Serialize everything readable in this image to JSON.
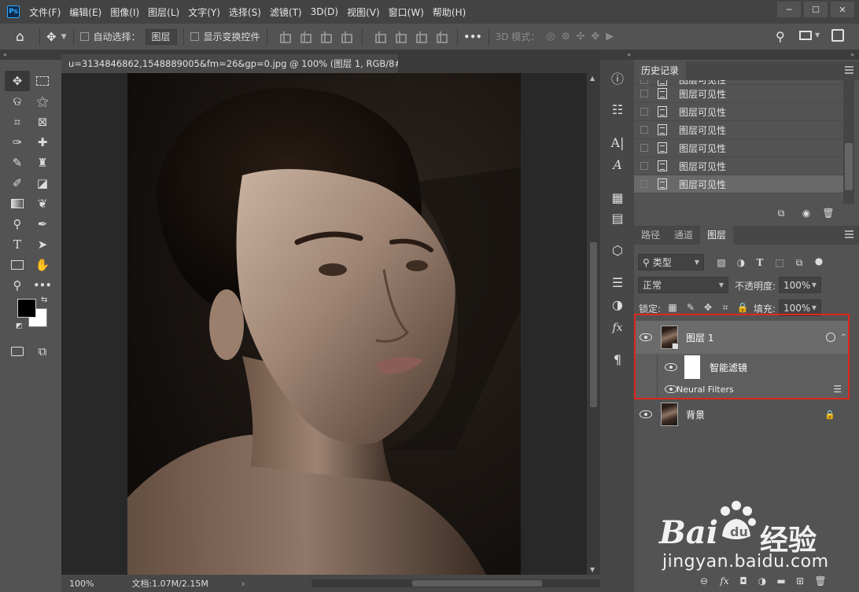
{
  "app": {
    "logo": "Ps",
    "menu": [
      "文件(F)",
      "编辑(E)",
      "图像(I)",
      "图层(L)",
      "文字(Y)",
      "选择(S)",
      "滤镜(T)",
      "3D(D)",
      "视图(V)",
      "窗口(W)",
      "帮助(H)"
    ],
    "window_controls": [
      "─",
      "☐",
      "✕"
    ]
  },
  "options_bar": {
    "auto_select_label": "自动选择：",
    "auto_select_target": "图层",
    "transform_controls_label": "显示变换控件",
    "more_label": "•••",
    "mode_3d_label": "3D 模式："
  },
  "document": {
    "tab_title": "u=3134846862,1548889005&fm=26&gp=0.jpg @ 100% (图层 1, RGB/8#) *",
    "zoom": "100%",
    "doc_size": "文档:1.07M/2.15M"
  },
  "history_panel": {
    "tab": "历史记录",
    "items": [
      "图层可见性",
      "图层可见性",
      "图层可见性",
      "图层可见性",
      "图层可见性",
      "图层可见性",
      "图层可见性"
    ]
  },
  "layers_panel": {
    "tabs": [
      "路径",
      "通道",
      "图层"
    ],
    "filter_kind": "类型",
    "blend_mode": "正常",
    "opacity_label": "不透明度:",
    "opacity_value": "100%",
    "lock_label": "锁定:",
    "fill_label": "填充:",
    "fill_value": "100%",
    "layers": [
      {
        "name": "图层 1",
        "type": "smart-object",
        "visible": true
      },
      {
        "name": "智能滤镜",
        "type": "smart-filters",
        "visible": true
      },
      {
        "name": "Neural Filters",
        "type": "filter",
        "visible": true
      },
      {
        "name": "背景",
        "type": "background",
        "visible": true,
        "locked": true
      }
    ]
  },
  "watermark": {
    "brand": "Bai",
    "brand_suffix": "经验",
    "url": "jingyan.baidu.com"
  },
  "colors": {
    "accent_ps": "#31a8ff",
    "highlight_box": "#e0261d",
    "selected_layer": "#6b6b6b"
  }
}
